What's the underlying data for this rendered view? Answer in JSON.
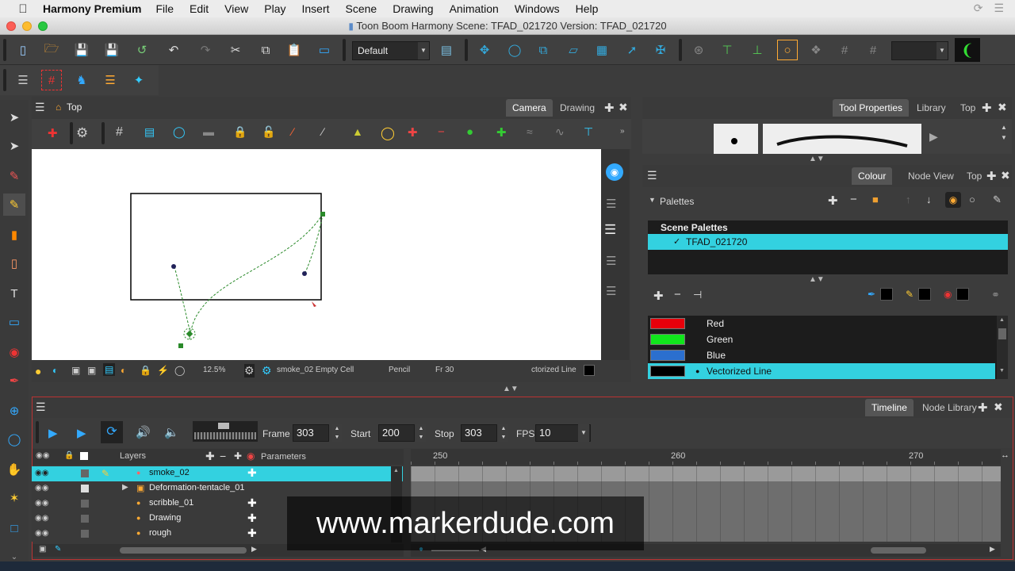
{
  "menubar": {
    "app_name": "Harmony Premium",
    "items": [
      "File",
      "Edit",
      "View",
      "Play",
      "Insert",
      "Scene",
      "Drawing",
      "Animation",
      "Windows",
      "Help"
    ]
  },
  "window": {
    "title": "Toon Boom Harmony Scene: TFAD_021720 Version: TFAD_021720"
  },
  "toolbar": {
    "workspace": "Default"
  },
  "camera_view": {
    "breadcrumb": "Top",
    "tabs": [
      "Camera",
      "Drawing"
    ],
    "active_tab": "Camera",
    "status": {
      "zoom": "12.5%",
      "cell": "smoke_02 Empty Cell",
      "tool": "Pencil",
      "frame": "Fr 30",
      "colour": "ctorized Line"
    }
  },
  "tool_properties": {
    "tabs": [
      "Tool Properties",
      "Library",
      "Top"
    ]
  },
  "colour_panel": {
    "tabs": [
      "Colour",
      "Node View",
      "Top"
    ],
    "palettes_label": "Palettes",
    "scene_palettes_label": "Scene Palettes",
    "palette_name": "TFAD_021720",
    "colours": [
      {
        "name": "Red",
        "hex": "#e8000b"
      },
      {
        "name": "Green",
        "hex": "#11e61c"
      },
      {
        "name": "Blue",
        "hex": "#2b6fcf"
      },
      {
        "name": "Vectorized Line",
        "hex": "#000000"
      }
    ],
    "selected_colour": "Vectorized Line"
  },
  "timeline": {
    "tabs": [
      "Timeline",
      "Node Library"
    ],
    "frame_label": "Frame",
    "frame": "303",
    "start_label": "Start",
    "start": "200",
    "stop_label": "Stop",
    "stop": "303",
    "fps_label": "FPS",
    "fps": "10",
    "layers_header": "Layers",
    "parameters_header": "Parameters",
    "ruler": [
      "250",
      "260",
      "270"
    ],
    "layers": [
      {
        "name": "smoke_02",
        "selected": true
      },
      {
        "name": "Deformation-tentacle_01",
        "selected": false
      },
      {
        "name": "scribble_01",
        "selected": false
      },
      {
        "name": "Drawing",
        "selected": false
      },
      {
        "name": "rough",
        "selected": false
      }
    ]
  },
  "watermark": "www.markerdude.com",
  "colors": {
    "accent": "#33d1e0",
    "panel_border": "#b33333"
  }
}
